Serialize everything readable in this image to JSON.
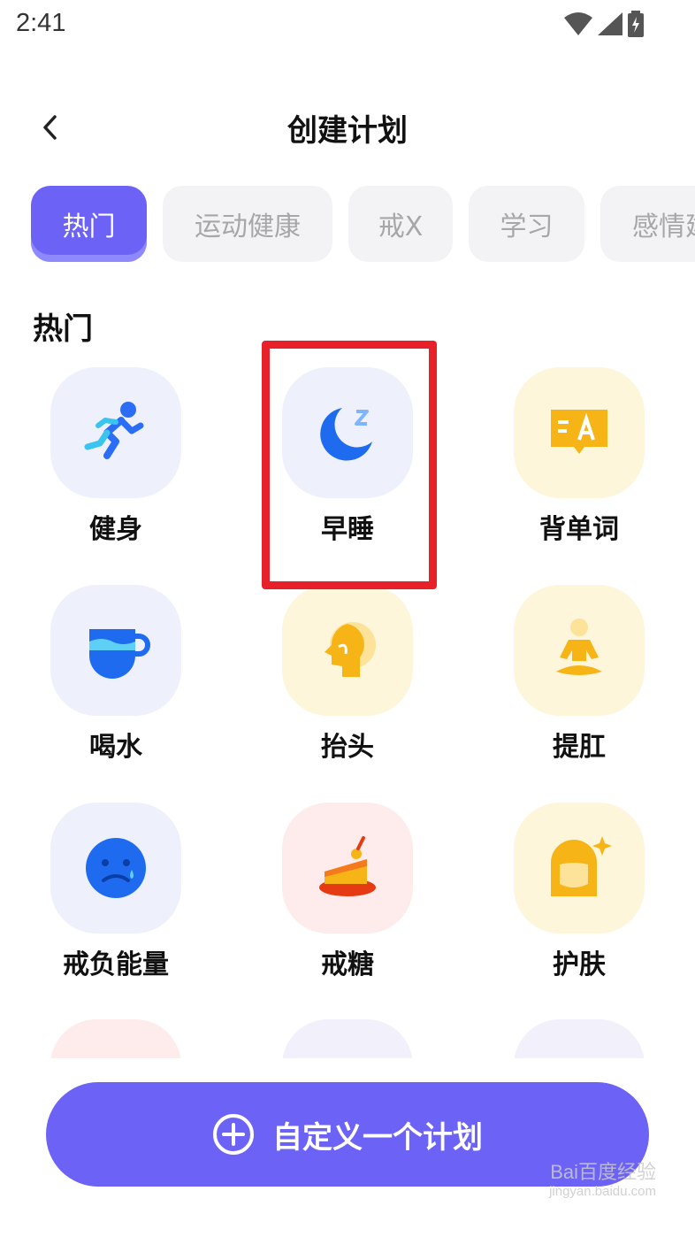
{
  "status_bar": {
    "time": "2:41"
  },
  "header": {
    "title": "创建计划"
  },
  "tabs": [
    {
      "label": "热门"
    },
    {
      "label": "运动健康"
    },
    {
      "label": "戒X"
    },
    {
      "label": "学习"
    },
    {
      "label": "感情建"
    }
  ],
  "section": {
    "title": "热门"
  },
  "items": [
    {
      "label": "健身",
      "icon": "running-person-icon"
    },
    {
      "label": "早睡",
      "icon": "moon-sleep-icon"
    },
    {
      "label": "背单词",
      "icon": "translate-bubble-icon"
    },
    {
      "label": "喝水",
      "icon": "cup-icon"
    },
    {
      "label": "抬头",
      "icon": "head-profile-icon"
    },
    {
      "label": "提肛",
      "icon": "meditation-person-icon"
    },
    {
      "label": "戒负能量",
      "icon": "sad-face-icon"
    },
    {
      "label": "戒糖",
      "icon": "cake-icon"
    },
    {
      "label": "护肤",
      "icon": "face-sparkle-icon"
    }
  ],
  "cta": {
    "label": "自定义一个计划"
  },
  "watermark": {
    "brand": "Bai百度经验",
    "url": "jingyan.baidu.com"
  },
  "colors": {
    "accent": "#6c63f6",
    "highlight": "#e8202a"
  }
}
